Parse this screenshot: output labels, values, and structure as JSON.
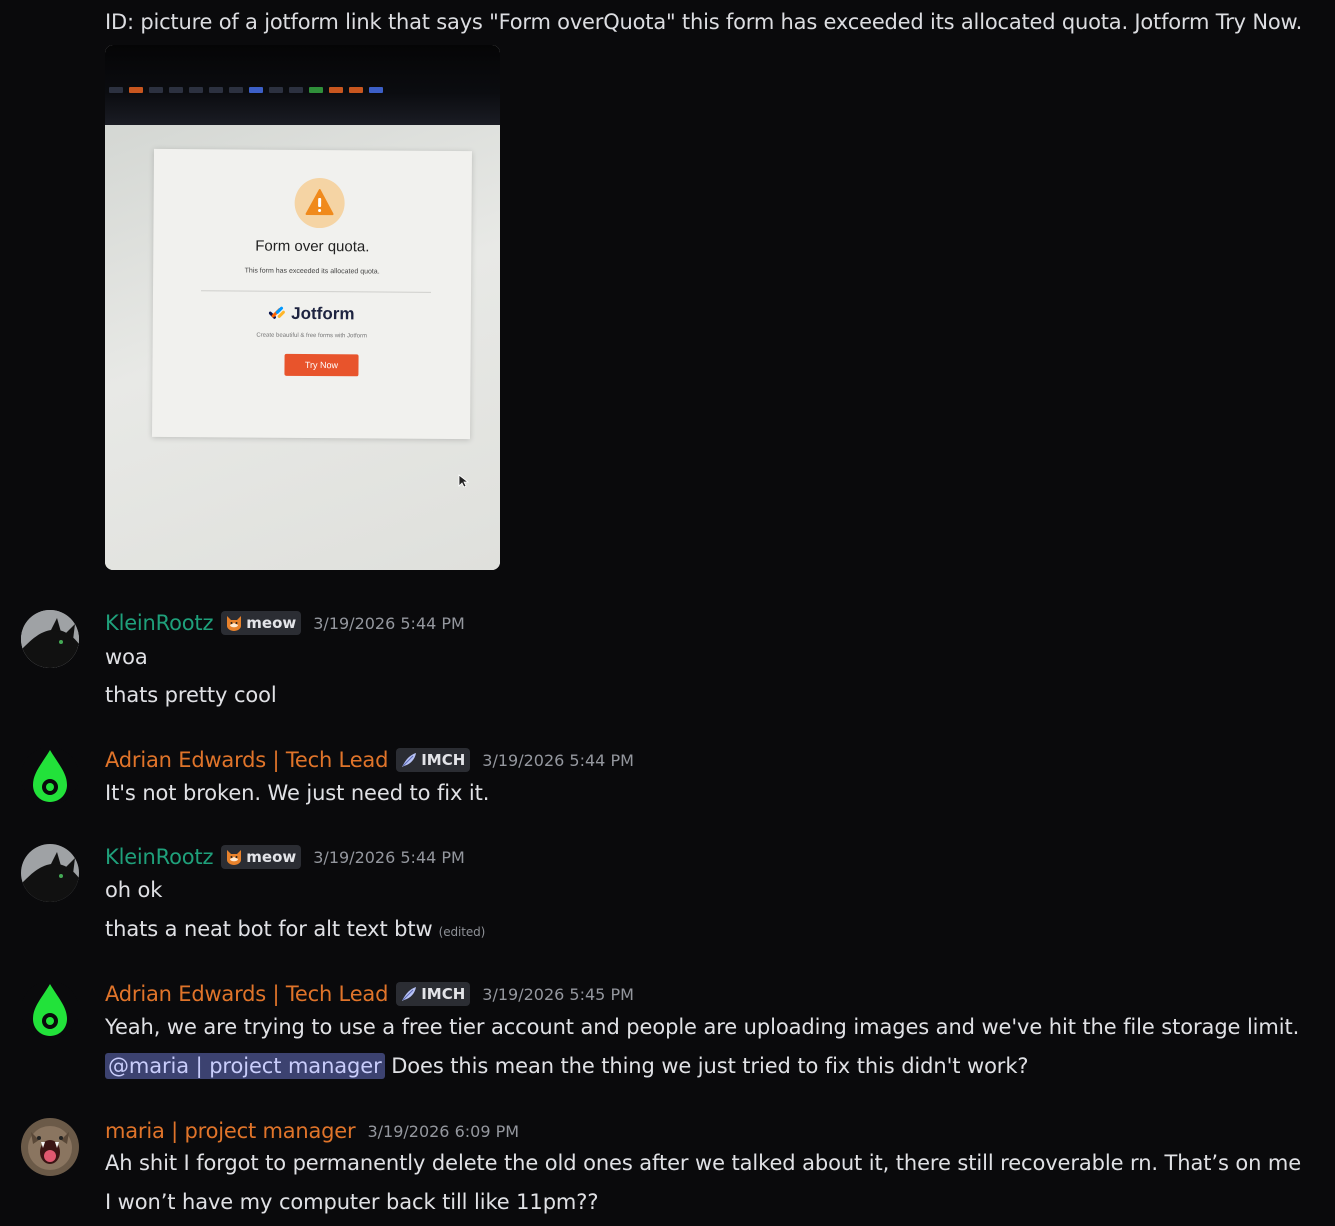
{
  "alt_text": "ID: picture of a jotform link that says \"Form overQuota\" this form has exceeded its allocated quota. Jotform Try Now.",
  "image": {
    "title": "Form over quota.",
    "subtitle": "This form has exceeded its allocated quota.",
    "brand": "Jotform",
    "tagline": "Create beautiful & free forms with Jotform",
    "button": "Try Now"
  },
  "messages": [
    {
      "author": "KleinRootz",
      "tag": "meow",
      "timestamp": "3/19/2026 5:44 PM",
      "lines": [
        "woa",
        "thats pretty cool"
      ]
    },
    {
      "author": "Adrian Edwards | Tech Lead",
      "tag": "IMCH",
      "timestamp": "3/19/2026 5:44 PM",
      "lines": [
        "It's not broken. We just need to fix it."
      ]
    },
    {
      "author": "KleinRootz",
      "tag": "meow",
      "timestamp": "3/19/2026 5:44 PM",
      "lines": [
        "oh ok",
        "thats a neat bot for  alt text btw"
      ],
      "edited": "(edited)"
    },
    {
      "author": "Adrian Edwards | Tech Lead",
      "tag": "IMCH",
      "timestamp": "3/19/2026 5:45 PM",
      "lines": [
        "Yeah, we are trying to use a free tier account and people are uploading images and we've hit the file storage limit."
      ],
      "mention": "@maria | project manager",
      "mention_text": " Does this mean the thing we just tried to fix this didn't work?"
    },
    {
      "author": "maria | project manager",
      "timestamp": "3/19/2026 6:09 PM",
      "lines": [
        "Ah shit I forgot to permanently delete the old ones after we talked about it, there still recoverable rn. That’s on me",
        "I won’t have my computer back till like 11pm??"
      ]
    }
  ],
  "colors": {
    "background": "#0a0a0c",
    "kleinrootz_name": "#1fa07b",
    "adrian_name": "#e0742a",
    "maria_name": "#e0742a",
    "mention_bg": "#3c4270"
  },
  "icons": {
    "kleinrootz_avatar": "black-cat-avatar",
    "adrian_avatar": "green-leaf-logo-avatar",
    "maria_avatar": "cat-yawning-avatar",
    "meow_tag": "shiba-face-icon",
    "imch_tag": "feather-icon"
  }
}
